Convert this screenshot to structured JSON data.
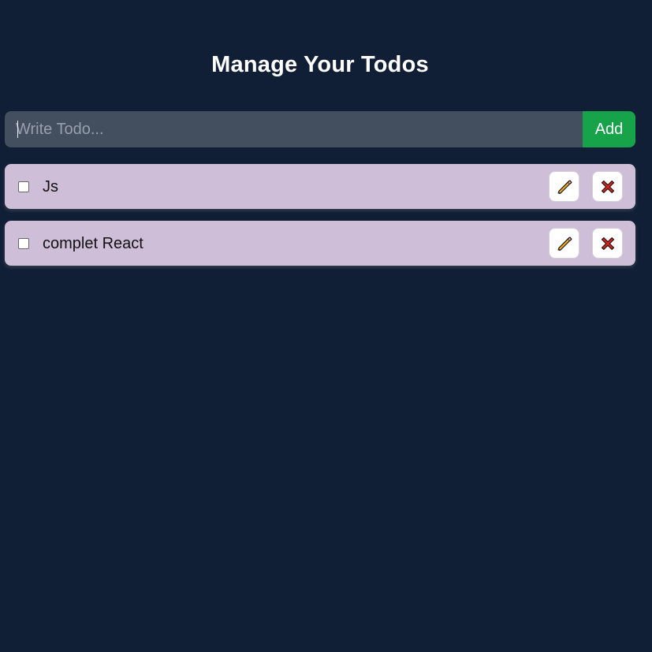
{
  "header": {
    "title": "Manage Your Todos"
  },
  "form": {
    "input_placeholder": "Write Todo...",
    "input_value": "",
    "add_label": "Add"
  },
  "todos": [
    {
      "text": "Js",
      "completed": false,
      "edit_icon": "pencil-icon",
      "delete_icon": "cross-icon"
    },
    {
      "text": "complet React",
      "completed": false,
      "edit_icon": "pencil-icon",
      "delete_icon": "cross-icon"
    }
  ],
  "colors": {
    "background": "#111f36",
    "input_background": "#434e5f",
    "add_button": "#16a34a",
    "todo_background": "#cebed8",
    "pencil": "#f5b21a",
    "cross": "#d1271f"
  }
}
